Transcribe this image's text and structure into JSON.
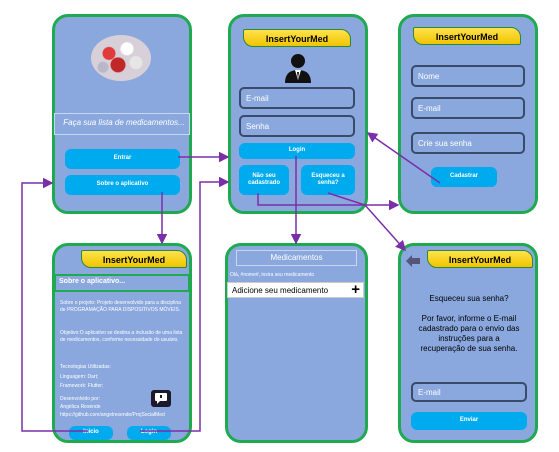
{
  "splash": {
    "tagline": "Faça sua lista de medicamentos...",
    "enter_label": "Entrar",
    "about_label": "Sobre o aplicativo"
  },
  "brand": "InsertYourMed",
  "login": {
    "email_placeholder": "E-mail",
    "password_placeholder": "Senha",
    "login_label": "Login",
    "no_account_label": "Não seu cadastrado",
    "forgot_label": "Esqueceu a senha?"
  },
  "register": {
    "name_placeholder": "Nome",
    "email_placeholder": "E-mail",
    "password_placeholder": "Crie sua senha",
    "register_label": "Cadastrar"
  },
  "about": {
    "header": "Sobre o aplicativo...",
    "project": "Sobre o projeto: Projeto desenvolvido para a disciplina de PROGRAMAÇÃO PARA DISPOSITIVOS MÓVEIS.",
    "objective": "Objetivo:O aplicativo se destina a inclusão de uma lista de medicamentos, conforme necessidade do usuário.",
    "tech_title": "Tecnologias Utilizadas:",
    "language": "Linguagem: Dart;",
    "framework": "Framework: Flutter;",
    "developer_title": "Desenvolvido por:",
    "developer_name": "Angélica Resende",
    "github": "https://github.com/angelresende/ProjSocialMed",
    "home_label": "Inicio",
    "login_label": "Login"
  },
  "medications": {
    "title": "Medicamentos",
    "greeting": "Olá, #nome#, insira seu medicamento",
    "add_label": "Adicione seu medicamento",
    "add_icon": "plus-icon"
  },
  "forgot": {
    "heading": "Esqueceu sua senha?",
    "instructions": "Por favor, informe o E-mail cadastrado para o envio das instruções para a recuperação de sua senha.",
    "email_placeholder": "E-mail",
    "send_label": "Enviar",
    "back_icon": "arrow-left-icon"
  },
  "colors": {
    "screen_bg": "#8aa8de",
    "frame_border": "#1faa50",
    "button": "#00aaee",
    "arrow": "#7a2fa8",
    "banner": "#f0c400"
  }
}
